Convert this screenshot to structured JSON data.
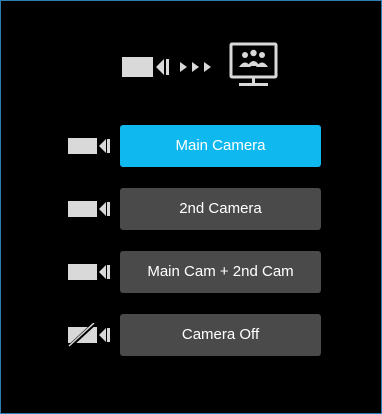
{
  "header": {
    "source_icon": "camera-icon",
    "flow_icon": "triple-arrow-icon",
    "target_icon": "monitor-meeting-icon"
  },
  "options": [
    {
      "label": "Main Camera",
      "icon": "camera-icon",
      "selected": true
    },
    {
      "label": "2nd Camera",
      "icon": "camera-icon",
      "selected": false
    },
    {
      "label": "Main Cam + 2nd Cam",
      "icon": "camera-icon",
      "selected": false
    },
    {
      "label": "Camera Off",
      "icon": "camera-off-icon",
      "selected": false
    }
  ],
  "colors": {
    "selected": "#10b8f0",
    "button": "#4a4a4a",
    "icon": "#d9d9d9",
    "border": "#2c7fb3",
    "background": "#000000"
  }
}
